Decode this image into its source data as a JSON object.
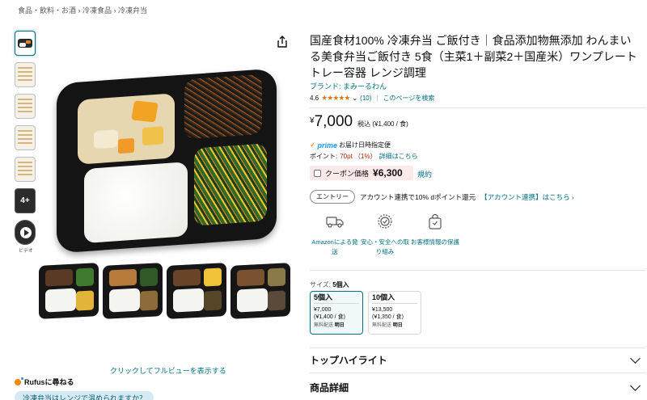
{
  "breadcrumb": "食品・飲料・お酒 › 冷凍食品 › 冷凍弁当",
  "thumbnails": {
    "more_count": "4+",
    "video_label": "ビデオ"
  },
  "gallery": {
    "expand_link": "クリックしてフルビューを表示する"
  },
  "rufus": {
    "label": "Rufusに尋ねる",
    "question": "冷凍弁当はレンジで温められますか？"
  },
  "product": {
    "title": "国産食材100% 冷凍弁当 ご飯付き｜食品添加物無添加 わんまいる美食弁当ご飯付き 5食（主菜1＋副菜2＋国産米）ワンプレート トレー容器 レンジ調理",
    "brand": "ブランド: まみーるわん",
    "rating": "4.6",
    "stars": "★★★★★",
    "rating_count": "(10)",
    "search_link": "このページを検索"
  },
  "price": {
    "symbol": "¥",
    "value": "7,000",
    "tax": "税込 (¥1,400 / 食)"
  },
  "prime": {
    "check": "✓",
    "word": "prime",
    "text": "お届け日時指定便"
  },
  "points": {
    "label": "ポイント:",
    "value": "70pt （1%）",
    "link": "詳細はこちら"
  },
  "coupon": {
    "label": "クーポン価格",
    "price": "¥6,300",
    "link": "規約"
  },
  "account": {
    "button": "エントリー",
    "text": "アカウント連携で10% dポイント還元",
    "link": "【アカウント連携】はこちら ›"
  },
  "features": [
    {
      "label": "Amazonによる発送"
    },
    {
      "label": "安心・安全への取り組み"
    },
    {
      "label": "お客様情報の保護"
    }
  ],
  "size": {
    "label": "サイズ:",
    "selected": "5個入",
    "options": [
      {
        "name": "5個入",
        "price": "¥7,000",
        "unit": "(¥1,400 / 食)",
        "ship_label": "無料配送",
        "ship_day": "明日"
      },
      {
        "name": "10個入",
        "price": "¥13,500",
        "unit": "(¥1,350 / 食)",
        "ship_label": "無料配送",
        "ship_day": "明日"
      }
    ]
  },
  "sections": [
    {
      "label": "トップハイライト"
    },
    {
      "label": "商品詳細"
    }
  ],
  "colors": {
    "link": "#007185",
    "price_red": "#b12704",
    "star": "#de7921",
    "prime_blue": "#1a98ff"
  }
}
